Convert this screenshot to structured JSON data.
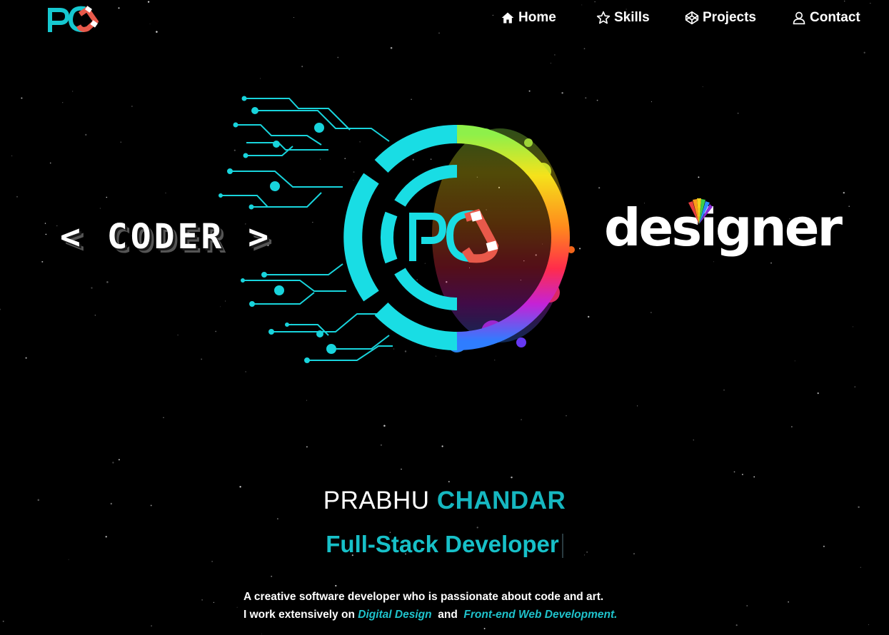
{
  "colors": {
    "background": "#000000",
    "accent": "#16b7c0",
    "text": "#ffffff"
  },
  "nav": {
    "logo_text": "PC",
    "items": [
      {
        "label": "Home",
        "icon": "home-icon"
      },
      {
        "label": "Skills",
        "icon": "star-icon"
      },
      {
        "label": "Projects",
        "icon": "codepen-icon"
      },
      {
        "label": "Contact",
        "icon": "user-icon"
      }
    ]
  },
  "hero": {
    "left_text": "< CODER >",
    "center_logo_text": "PC",
    "right_text": "designer"
  },
  "intro": {
    "first_name": "PRABHU",
    "last_name": "CHANDAR",
    "role": "Full-Stack Developer",
    "line1": "A creative software developer who is passionate about code and art.",
    "line2_prefix": "I work extensively on",
    "highlight1": "Digital Design",
    "connector": "and",
    "highlight2": "Front-end Web Development."
  }
}
